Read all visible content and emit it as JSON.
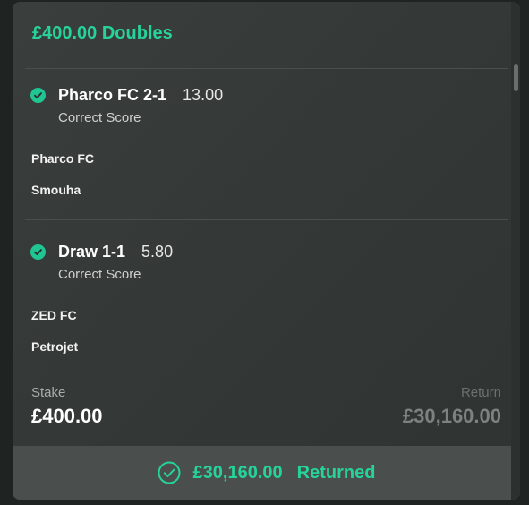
{
  "bet": {
    "title": "£400.00 Doubles",
    "selections": [
      {
        "name": "Pharco FC 2-1",
        "odds": "13.00",
        "market": "Correct Score",
        "home_team": "Pharco FC",
        "away_team": "Smouha"
      },
      {
        "name": "Draw 1-1",
        "odds": "5.80",
        "market": "Correct Score",
        "home_team": "ZED FC",
        "away_team": "Petrojet"
      }
    ],
    "stake_label": "Stake",
    "stake_value": "£400.00",
    "return_label": "Return",
    "return_value": "£30,160.00"
  },
  "footer": {
    "amount": "£30,160.00",
    "status": "Returned"
  },
  "colors": {
    "accent": "#26d39b",
    "card_bg": "#363a38",
    "footer_bg": "#4a4e4c"
  },
  "icons": {
    "selection_status": "check-circle-icon",
    "footer_status": "check-outline-circle-icon"
  }
}
